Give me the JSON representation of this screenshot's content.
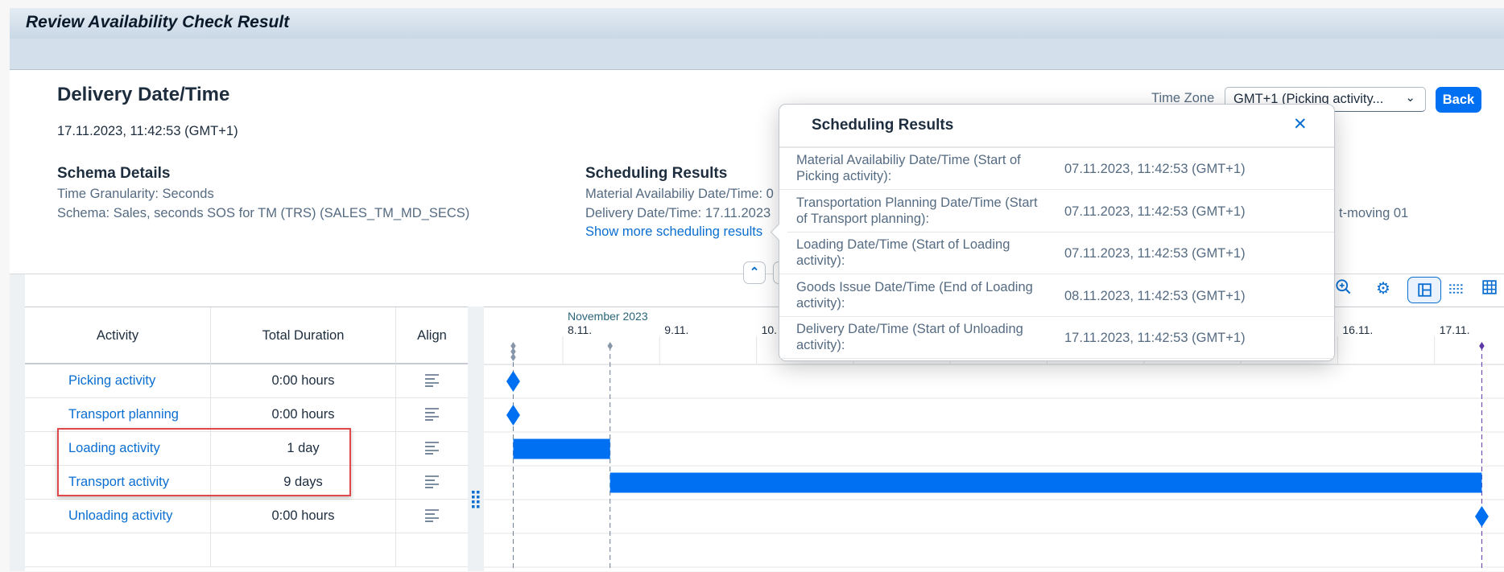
{
  "window": {
    "title": "Review Availability Check Result"
  },
  "header": {
    "title": "Delivery Date/Time",
    "datetime": "17.11.2023, 11:42:53 (GMT+1)",
    "time_zone_label": "Time Zone",
    "time_zone_value": "GMT+1 (Picking activity...",
    "back_label": "Back",
    "schema": {
      "title": "Schema Details",
      "lines": [
        "Time Granularity: Seconds",
        "Schema: Sales, seconds SOS for TM (TRS) (SALES_TM_MD_SECS)"
      ]
    },
    "scheduling": {
      "title": "Scheduling Results",
      "lines": [
        "Material Availabiliy Date/Time: 0",
        "Delivery Date/Time: 17.11.2023"
      ],
      "link": "Show more scheduling results"
    },
    "third_column_fragment": "t-moving 01"
  },
  "toolbar": {
    "icons": [
      "zoom-in-icon",
      "settings-icon",
      "layout-icon",
      "dotted-lines-icon",
      "table-icon"
    ],
    "selected": "layout-icon"
  },
  "table": {
    "columns": [
      "Activity",
      "Total Duration",
      "Align"
    ],
    "rows": [
      {
        "activity": "Picking activity",
        "duration": "0:00 hours",
        "start": "2023-11-07T11:42:53",
        "end": "2023-11-07T11:42:53"
      },
      {
        "activity": "Transport planning",
        "duration": "0:00 hours",
        "start": "2023-11-07T11:42:53",
        "end": "2023-11-07T11:42:53"
      },
      {
        "activity": "Loading activity",
        "duration": "1 day",
        "start": "2023-11-07T11:42:53",
        "end": "2023-11-08T11:42:53"
      },
      {
        "activity": "Transport activity",
        "duration": "9 days",
        "start": "2023-11-08T11:42:53",
        "end": "2023-11-17T11:42:53"
      },
      {
        "activity": "Unloading activity",
        "duration": "0:00 hours",
        "start": "2023-11-17T11:42:53",
        "end": "2023-11-17T11:42:53"
      }
    ]
  },
  "gantt": {
    "month_label": "November 2023",
    "ticks": [
      {
        "date": "2023-11-08",
        "label": "8.11."
      },
      {
        "date": "2023-11-09",
        "label": "9.11."
      },
      {
        "date": "2023-11-10",
        "label": "10."
      },
      {
        "date": "2023-11-16",
        "label": "16.11."
      },
      {
        "date": "2023-11-17",
        "label": "17.11."
      }
    ],
    "grid_days": [
      "2023-11-08",
      "2023-11-09",
      "2023-11-10",
      "2023-11-11",
      "2023-11-12",
      "2023-11-13",
      "2023-11-14",
      "2023-11-15",
      "2023-11-16",
      "2023-11-17"
    ],
    "bar_color": "#0070f2",
    "delivery_marker_color": "#5d36a8"
  },
  "popup": {
    "title": "Scheduling Results",
    "rows": [
      {
        "label": "Material Availabiliy Date/Time (Start of Picking activity):",
        "value": "07.11.2023, 11:42:53 (GMT+1)"
      },
      {
        "label": "Transportation Planning Date/Time (Start of Transport planning):",
        "value": "07.11.2023, 11:42:53 (GMT+1)"
      },
      {
        "label": "Loading Date/Time (Start of Loading activity):",
        "value": "07.11.2023, 11:42:53 (GMT+1)"
      },
      {
        "label": "Goods Issue Date/Time (End of Loading activity):",
        "value": "08.11.2023, 11:42:53 (GMT+1)"
      },
      {
        "label": "Delivery Date/Time (Start of Unloading activity):",
        "value": "17.11.2023, 11:42:53 (GMT+1)"
      }
    ]
  },
  "highlight_color": "#e0484a"
}
